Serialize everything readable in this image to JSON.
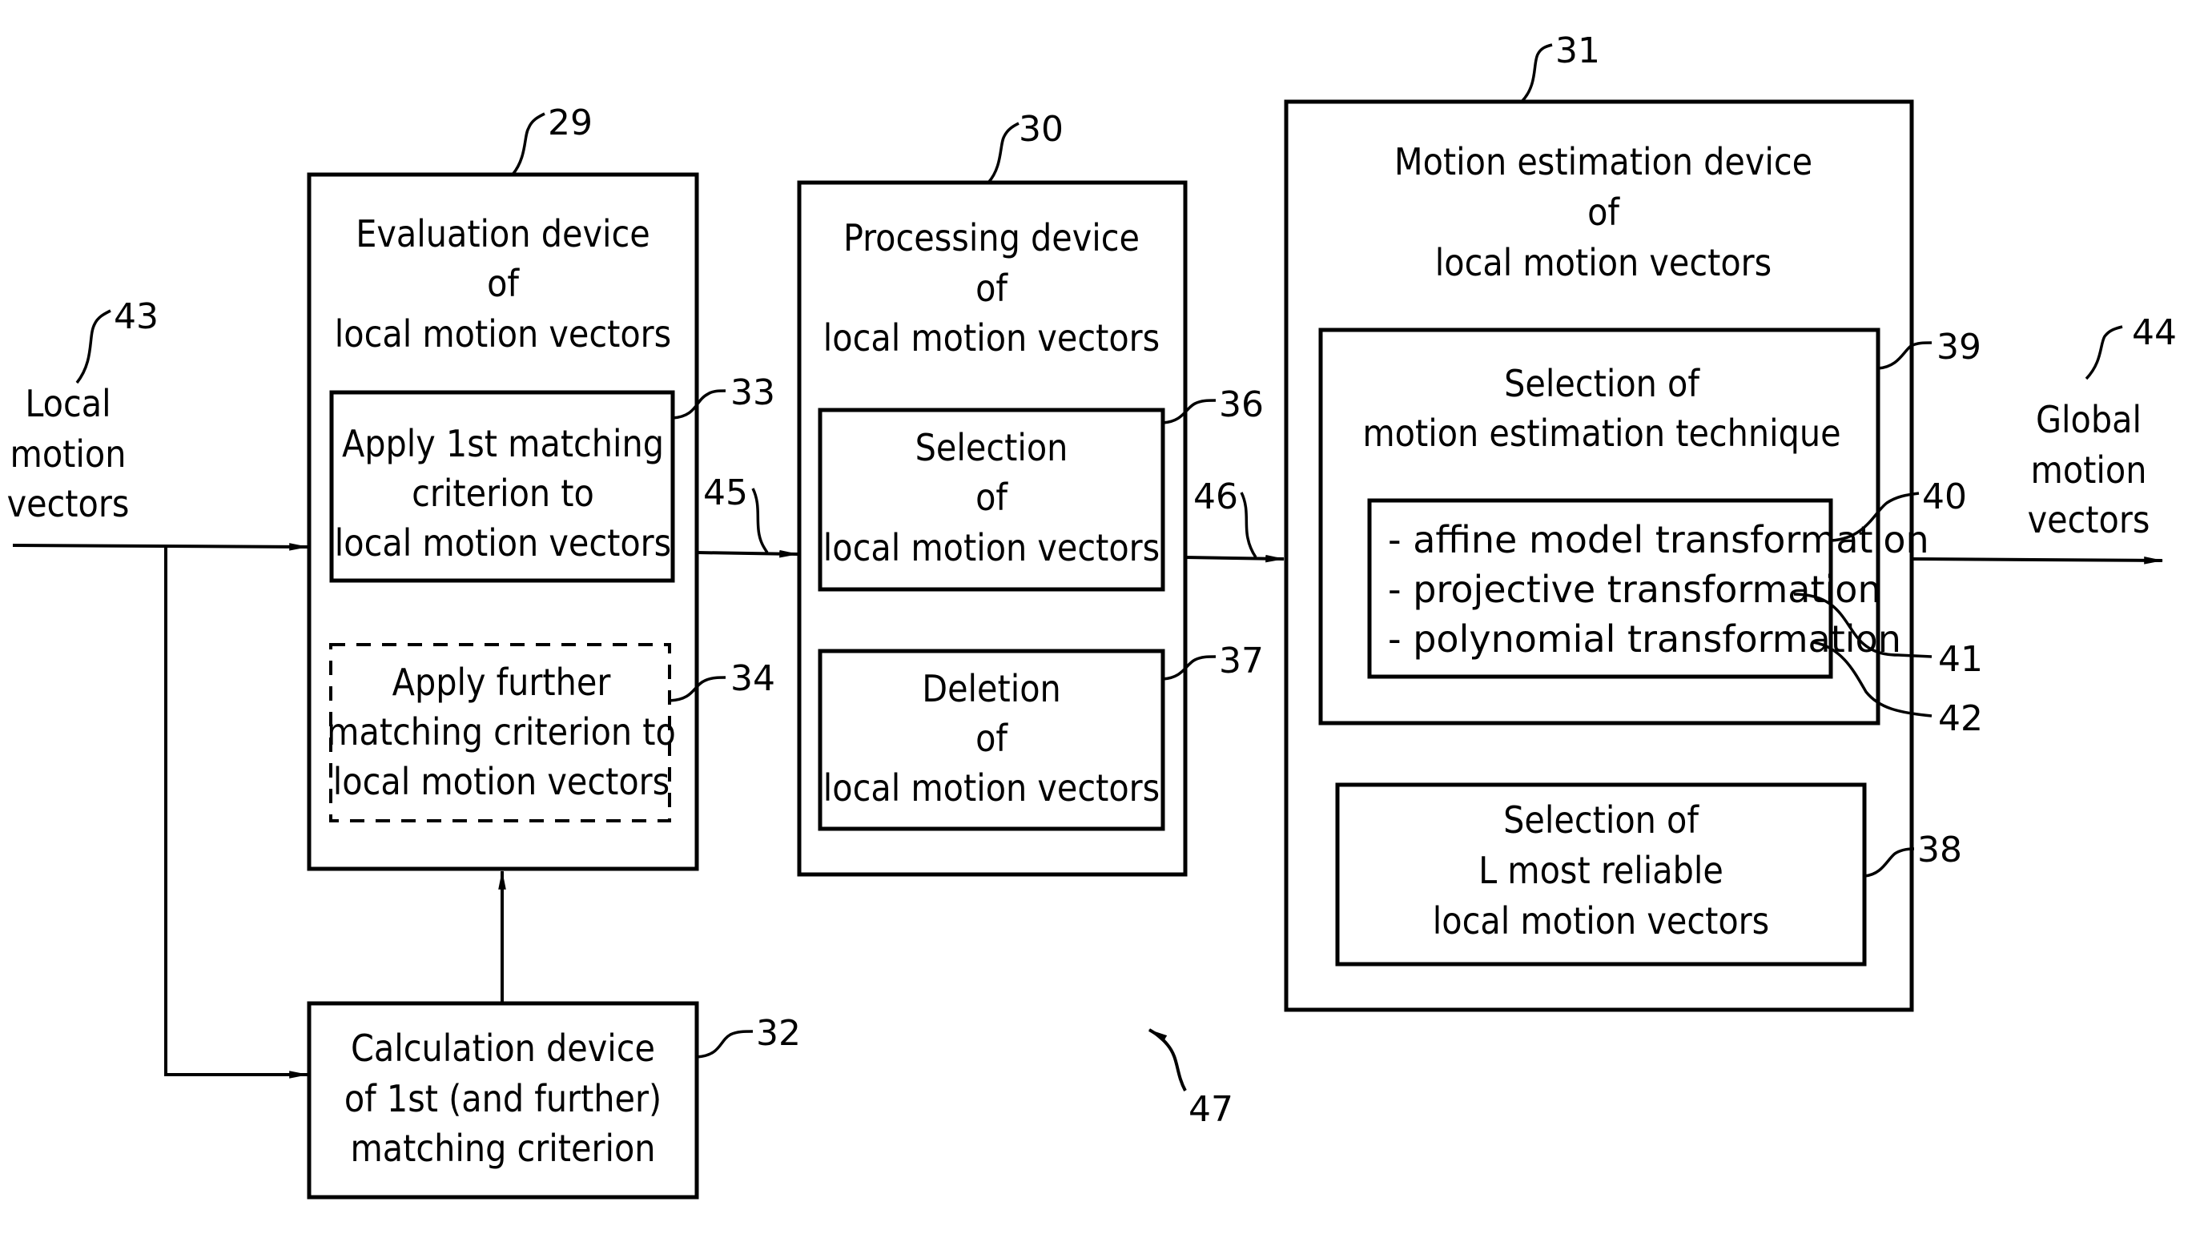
{
  "figure": {
    "blocks": {
      "evaluation": {
        "ref": "29",
        "title_lines": [
          "Evaluation device",
          "of",
          "local motion vectors"
        ],
        "first_criterion": {
          "ref": "33",
          "lines": [
            "Apply 1st matching",
            "criterion to",
            "local motion vectors"
          ]
        },
        "further_criterion": {
          "ref": "34",
          "lines": [
            "Apply further",
            "matching criterion to",
            "local motion vectors"
          ],
          "style": "dashed (optional)"
        }
      },
      "processing": {
        "ref": "30",
        "title_lines": [
          "Processing device",
          "of",
          "local motion vectors"
        ],
        "selection": {
          "ref": "36",
          "lines": [
            "Selection",
            "of",
            "local motion vectors"
          ]
        },
        "deletion": {
          "ref": "37",
          "lines": [
            "Deletion",
            "of",
            "local motion vectors"
          ]
        }
      },
      "motion_estimation": {
        "ref": "31",
        "title_lines": [
          "Motion estimation device",
          "of",
          "local motion vectors"
        ],
        "technique_selection": {
          "ref": "39",
          "lines": [
            "Selection of",
            "motion estimation technique"
          ],
          "techniques": [
            {
              "ref": "40",
              "label": "- affine model transformation"
            },
            {
              "ref": "41",
              "label": "- projective transformation"
            },
            {
              "ref": "42",
              "label": "- polynomial transformation"
            }
          ]
        },
        "reliable_selection": {
          "ref": "38",
          "lines": [
            "Selection of",
            "L most reliable",
            "local motion vectors"
          ]
        }
      },
      "calculation": {
        "ref": "32",
        "lines": [
          "Calculation device",
          "of 1st (and further)",
          "matching criterion"
        ]
      }
    },
    "input": {
      "ref": "43",
      "lines": [
        "Local",
        "motion",
        "vectors"
      ]
    },
    "output": {
      "ref": "44",
      "lines": [
        "Global",
        "motion",
        "vectors"
      ]
    },
    "connections": {
      "eval_to_processing": "45",
      "processing_to_estimation": "46"
    },
    "system_ref": "47"
  }
}
